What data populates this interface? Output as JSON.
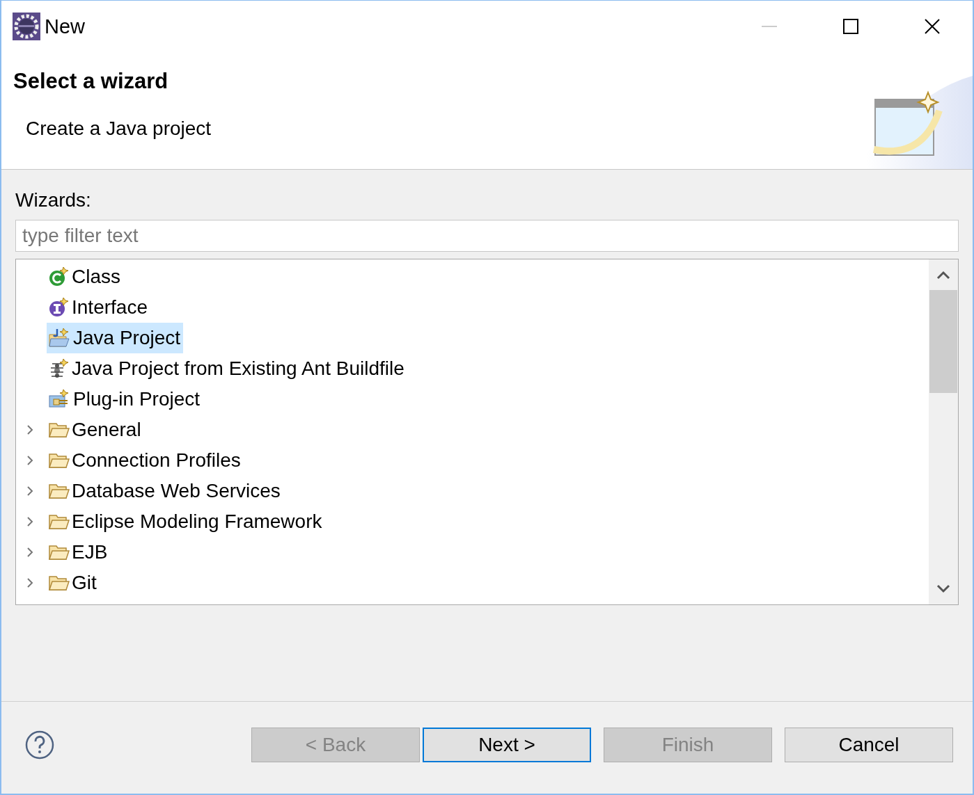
{
  "window": {
    "title": "New"
  },
  "header": {
    "title": "Select a wizard",
    "description": "Create a Java project"
  },
  "wizards_label": "Wizards:",
  "filter": {
    "placeholder": "type filter text"
  },
  "tree": [
    {
      "label": "Class",
      "kind": "class",
      "selected": false
    },
    {
      "label": "Interface",
      "kind": "interface",
      "selected": false
    },
    {
      "label": "Java Project",
      "kind": "java-project",
      "selected": true
    },
    {
      "label": "Java Project from Existing Ant Buildfile",
      "kind": "ant",
      "selected": false
    },
    {
      "label": "Plug-in Project",
      "kind": "plugin",
      "selected": false
    },
    {
      "label": "General",
      "kind": "folder",
      "selected": false,
      "expanded": false
    },
    {
      "label": "Connection Profiles",
      "kind": "folder",
      "selected": false,
      "expanded": false
    },
    {
      "label": "Database Web Services",
      "kind": "folder",
      "selected": false,
      "expanded": false
    },
    {
      "label": "Eclipse Modeling Framework",
      "kind": "folder",
      "selected": false,
      "expanded": false
    },
    {
      "label": "EJB",
      "kind": "folder",
      "selected": false,
      "expanded": false
    },
    {
      "label": "Git",
      "kind": "folder",
      "selected": false,
      "expanded": false
    }
  ],
  "buttons": [
    {
      "label": "< Back",
      "disabled": true,
      "default": false
    },
    {
      "label": "Next >",
      "disabled": false,
      "default": true
    },
    {
      "label": "Finish",
      "disabled": true,
      "default": false
    },
    {
      "label": "Cancel",
      "disabled": false,
      "default": false
    }
  ]
}
